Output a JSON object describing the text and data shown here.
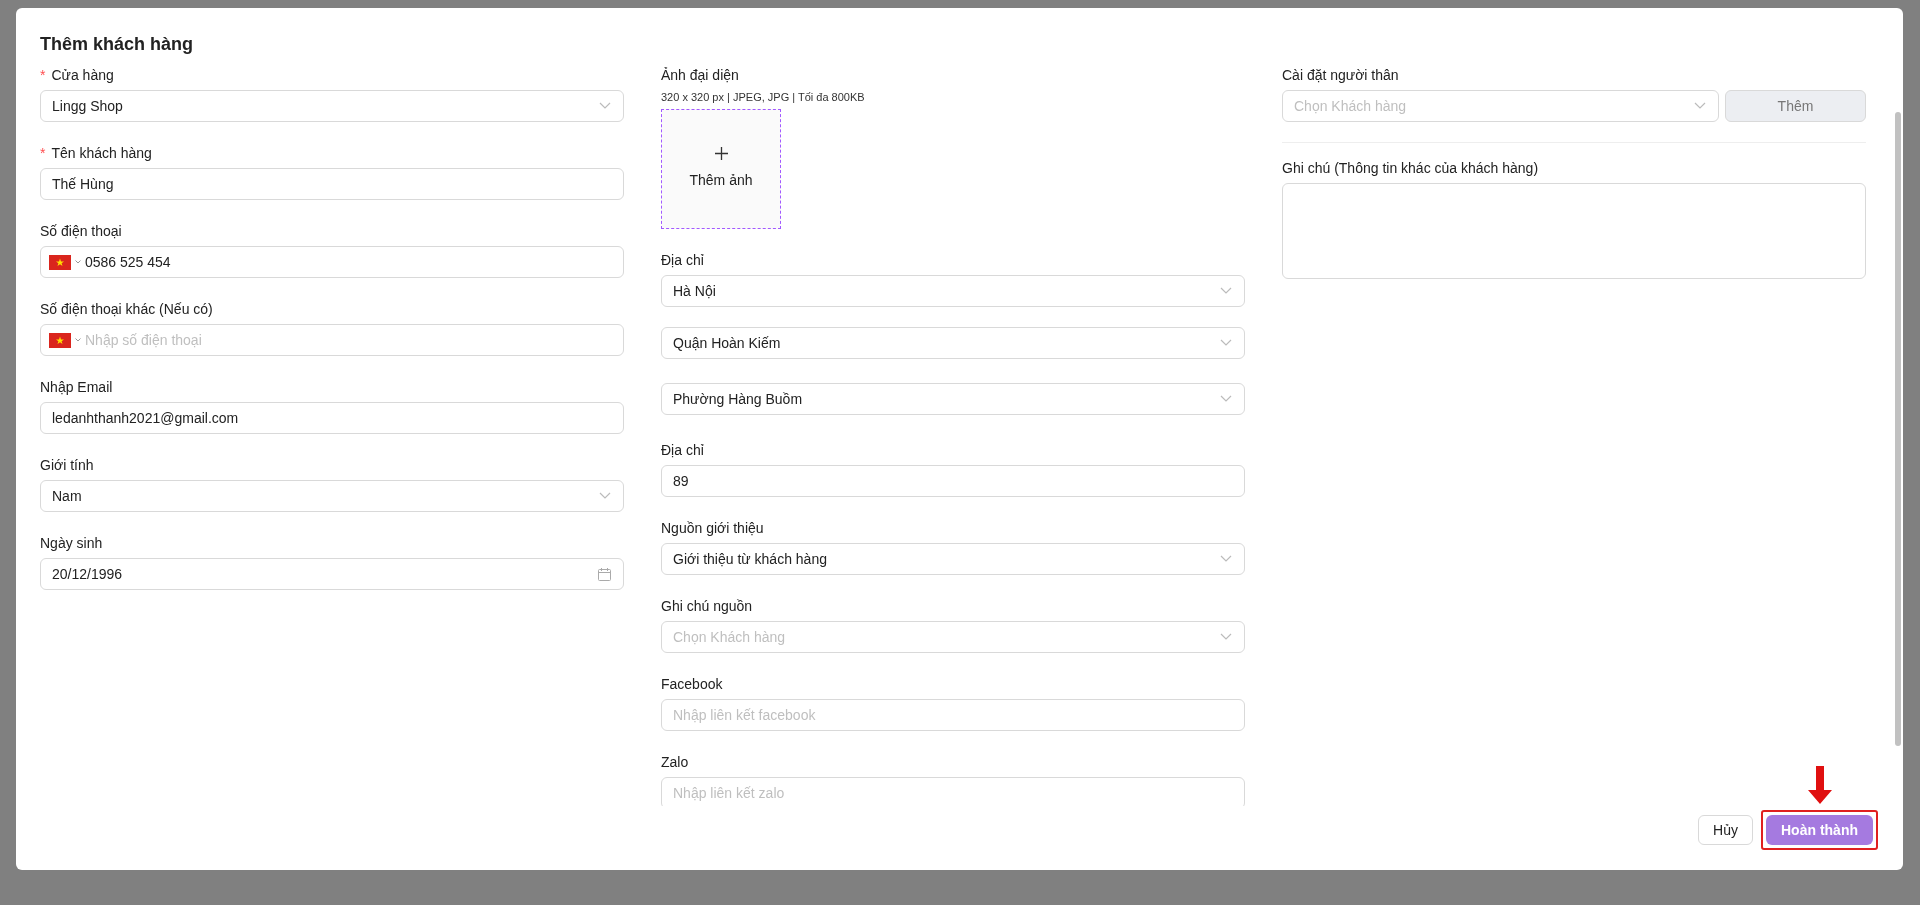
{
  "dialog": {
    "title": "Thêm khách hàng",
    "columns": [
      [
        {
          "kind": "select",
          "label": "Cửa hàng",
          "required_mark": "*",
          "value": "Lingg Shop"
        },
        {
          "kind": "text",
          "label": "Tên khách hàng",
          "required_mark": "*",
          "value": "Thế Hùng"
        },
        {
          "kind": "phone",
          "label": "Số điện thoại",
          "value": "0586 525 454"
        },
        {
          "kind": "phone",
          "label": "Số điện thoại khác (Nếu có)",
          "placeholder": "Nhập số điện thoại"
        },
        {
          "kind": "text",
          "label": "Nhập Email",
          "value": "ledanhthanh2021@gmail.com"
        },
        {
          "kind": "select",
          "label": "Giới tính",
          "value": "Nam"
        },
        {
          "kind": "date",
          "label": "Ngày sinh",
          "value": "20/12/1996"
        }
      ],
      [
        {
          "kind": "upload",
          "label": "Ảnh đại diện",
          "hint": "320 x 320 px | JPEG, JPG | Tối đa 800KB",
          "button_label": "Thêm ảnh"
        },
        {
          "kind": "select",
          "label": "Địa chỉ",
          "value": "Hà Nội"
        },
        {
          "kind": "select",
          "value": "Quận Hoàn Kiếm"
        },
        {
          "kind": "select",
          "value": "Phường Hàng Buồm"
        },
        {
          "kind": "text",
          "label": "Địa chỉ",
          "value": "89"
        },
        {
          "kind": "select",
          "label": "Nguồn giới thiệu",
          "value": "Giới thiệu từ khách hàng"
        },
        {
          "kind": "select",
          "label": "Ghi chú nguồn",
          "placeholder": "Chọn Khách hàng"
        },
        {
          "kind": "text",
          "label": "Facebook",
          "placeholder": "Nhập liên kết facebook"
        },
        {
          "kind": "text",
          "label": "Zalo",
          "placeholder": "Nhập liên kết zalo"
        }
      ],
      [
        {
          "kind": "select_add",
          "label": "Cài đặt người thân",
          "placeholder": "Chọn Khách hàng",
          "button_label": "Thêm"
        },
        {
          "kind": "divider"
        },
        {
          "kind": "textarea",
          "label": "Ghi chú (Thông tin khác của khách hàng)"
        }
      ]
    ],
    "buttons": [
      {
        "kind": "secondary",
        "label": "Hủy",
        "highlighted": false
      },
      {
        "kind": "primary",
        "label": "Hoàn thành",
        "highlighted": true
      }
    ]
  }
}
